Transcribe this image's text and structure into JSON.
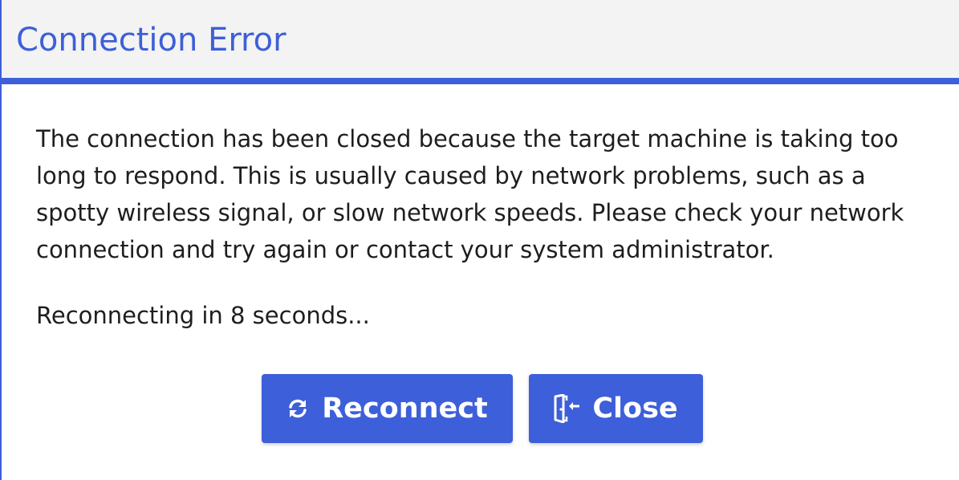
{
  "dialog": {
    "title": "Connection Error",
    "message": "The connection has been closed because the target machine is taking too long to respond. This is usually caused by network problems, such as a spotty wireless signal, or slow network speeds. Please check your network connection and try again or contact your system administrator.",
    "countdown": "Reconnecting in 8 seconds..."
  },
  "buttons": {
    "reconnect": {
      "label": "Reconnect",
      "icon": "refresh-icon"
    },
    "close": {
      "label": "Close",
      "icon": "exit-door-icon"
    }
  },
  "colors": {
    "accent": "#3d5fd9",
    "header_background": "#f3f3f3",
    "text": "#1e1e1e",
    "button_text": "#ffffff"
  }
}
